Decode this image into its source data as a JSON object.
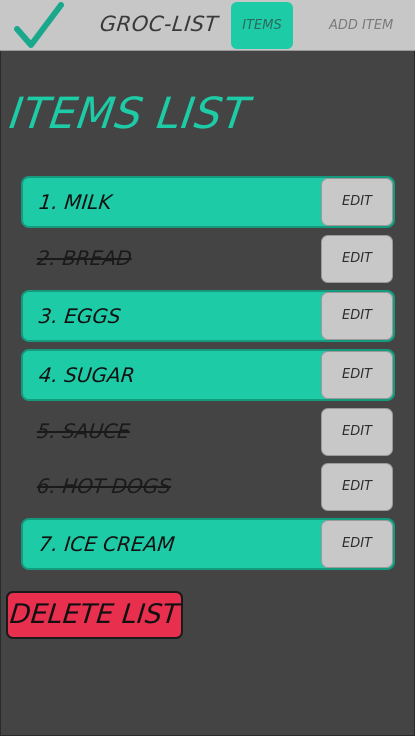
{
  "colors": {
    "accent": "#1dcca7",
    "background": "#444444",
    "nav_background": "#c7c7c7",
    "danger": "#e8304e",
    "button_gray": "#c8c8c8"
  },
  "nav": {
    "logo_icon": "checkmark-icon",
    "title": "GROC-LIST",
    "items_label": "ITEMS",
    "add_item_label": "ADD ITEM",
    "active_tab": "ITEMS"
  },
  "main": {
    "heading": "ITEMS LIST",
    "items": [
      {
        "label": "1. MILK",
        "done": false,
        "edit_label": "EDIT"
      },
      {
        "label": "2. BREAD",
        "done": true,
        "edit_label": "EDIT"
      },
      {
        "label": "3. EGGS",
        "done": false,
        "edit_label": "EDIT"
      },
      {
        "label": "4. SUGAR",
        "done": false,
        "edit_label": "EDIT"
      },
      {
        "label": "5. SAUCE",
        "done": true,
        "edit_label": "EDIT"
      },
      {
        "label": "6. HOT DOGS",
        "done": true,
        "edit_label": "EDIT"
      },
      {
        "label": "7. ICE CREAM",
        "done": false,
        "edit_label": "EDIT"
      }
    ],
    "delete_label": "DELETE LIST"
  }
}
